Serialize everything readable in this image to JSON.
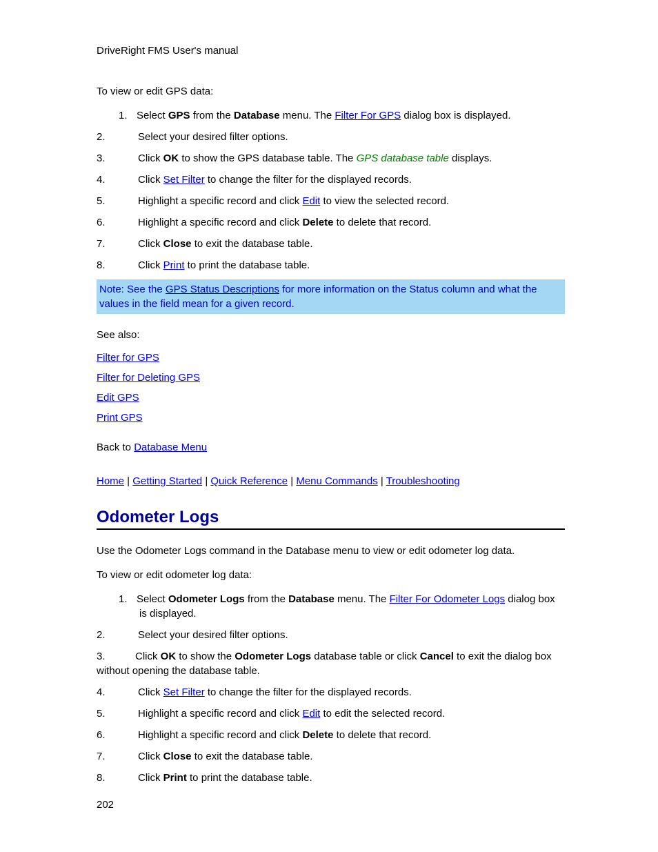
{
  "header": "DriveRight FMS User's manual",
  "gps": {
    "intro": "To view or edit GPS data:",
    "step1_pre": "Select ",
    "step1_b1": "GPS",
    "step1_mid": " from the ",
    "step1_b2": "Database",
    "step1_mid2": " menu. The ",
    "step1_link": "Filter For GPS",
    "step1_end": " dialog box is displayed.",
    "step2": "Select your desired filter options.",
    "step3_pre": "Click ",
    "step3_b1": "OK",
    "step3_mid": " to show the GPS database table. The ",
    "step3_green": "GPS database table",
    "step3_end": " displays.",
    "step4_pre": "Click ",
    "step4_link": "Set Filter",
    "step4_end": " to change the filter for the displayed records.",
    "step5_pre": "Highlight a specific record and click ",
    "step5_link": "Edit",
    "step5_end": " to view the selected record.",
    "step6_pre": "Highlight a specific record and click ",
    "step6_b": "Delete",
    "step6_end": " to delete that record.",
    "step7_pre": "Click ",
    "step7_b": "Close",
    "step7_end": " to exit the database table.",
    "step8_pre": "Click ",
    "step8_link": "Print",
    "step8_end": " to print the database table.",
    "note_pre": "Note: See the ",
    "note_link": "GPS Status Descriptions",
    "note_end": " for more information on the Status column and what the values in the field mean for a given record.",
    "see_also_label": "See also:",
    "see1": "Filter for GPS",
    "see2": "Filter for Deleting GPS",
    "see3": "Edit GPS",
    "see4": "Print GPS",
    "back_pre": "Back to ",
    "back_link": "Database Menu"
  },
  "nav": {
    "home": "Home",
    "getting_started": "Getting Started",
    "quick_ref": "Quick Reference",
    "menu_cmds": "Menu Commands",
    "trouble": "Troubleshooting"
  },
  "odo": {
    "title": "Odometer Logs",
    "intro": "Use the Odometer Logs command in the Database menu to view or edit odometer log data.",
    "lead": "To view or edit odometer log data:",
    "s1_pre": "Select ",
    "s1_b1": "Odometer Logs",
    "s1_mid": " from the ",
    "s1_b2": "Database",
    "s1_mid2": " menu. The ",
    "s1_link": "Filter For Odometer Logs",
    "s1_end": " dialog box is displayed.",
    "s2": "Select your desired filter options.",
    "s3_pre": "Click ",
    "s3_b1": "OK",
    "s3_mid": " to show the ",
    "s3_b2": "Odometer Logs",
    "s3_mid2": " database table or click ",
    "s3_b3": "Cancel",
    "s3_end": " to exit the dialog box without opening the database table.",
    "s4_pre": "Click ",
    "s4_link": "Set Filter",
    "s4_end": " to change the filter for the displayed records.",
    "s5_pre": "Highlight a specific record and click ",
    "s5_link": "Edit",
    "s5_end": " to edit the selected record.",
    "s6_pre": "Highlight a specific record and click ",
    "s6_b": "Delete",
    "s6_end": " to delete that record.",
    "s7_pre": "Click ",
    "s7_b": "Close",
    "s7_end": " to exit the database table.",
    "s8_pre": "Click ",
    "s8_b": "Print",
    "s8_end": " to print the database table."
  },
  "nums": {
    "n1": "1.",
    "n2": "2.",
    "n3": "3.",
    "n4": "4.",
    "n5": "5.",
    "n6": "6.",
    "n7": "7.",
    "n8": "8."
  },
  "page_number": "202",
  "pipe": " | "
}
